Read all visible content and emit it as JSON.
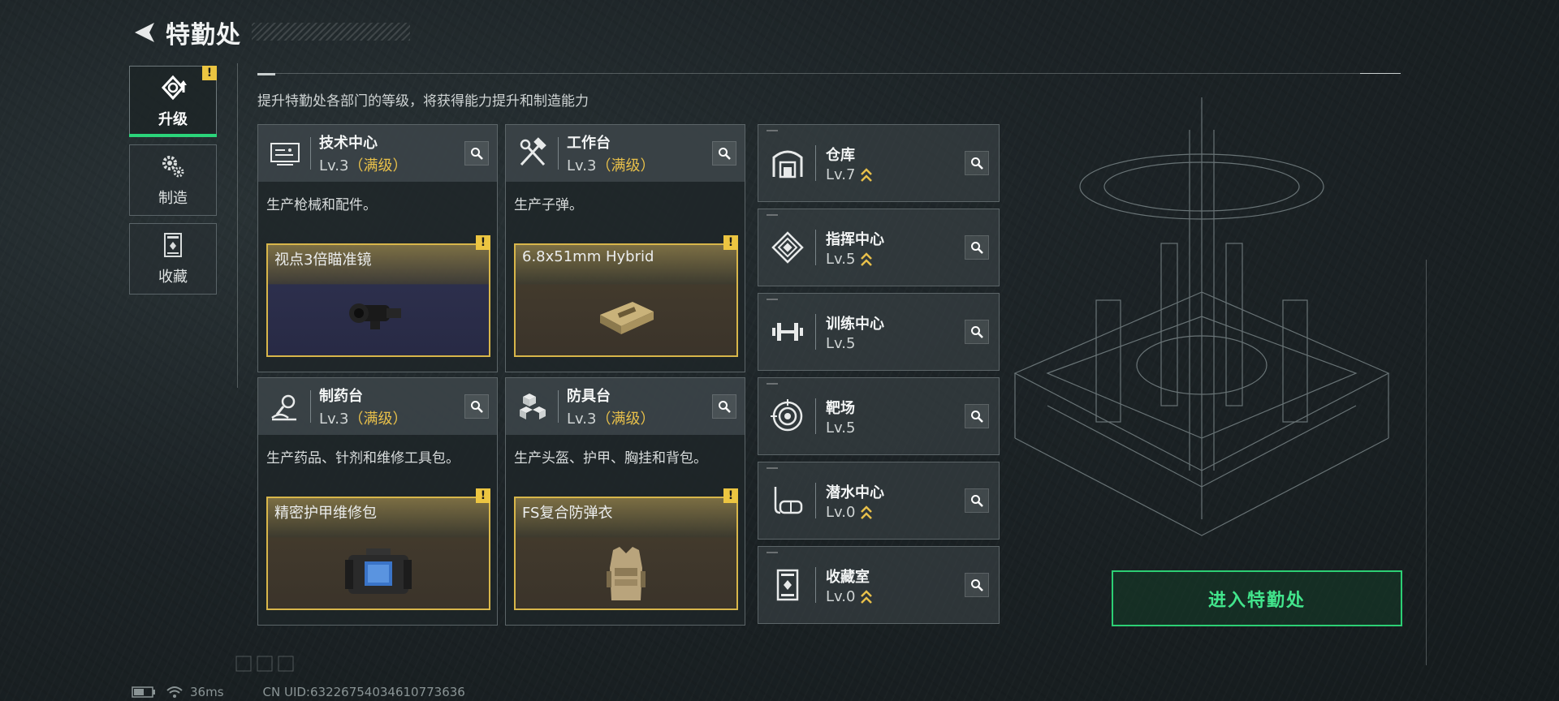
{
  "header": {
    "title": "特勤处"
  },
  "sidenav": [
    {
      "label": "升级",
      "icon": "upgrade-icon",
      "active": true,
      "warning": "!"
    },
    {
      "label": "制造",
      "icon": "gears-icon",
      "active": false
    },
    {
      "label": "收藏",
      "icon": "collection-icon",
      "active": false
    }
  ],
  "subtitle": "提升特勤处各部门的等级，将获得能力提升和制造能力",
  "cards": [
    {
      "name": "技术中心",
      "level": "Lv.3",
      "max": "（满级）",
      "icon": "tech-center-icon",
      "desc": "生产枪械和配件。",
      "product": "视点3倍瞄准镜",
      "warning": "!"
    },
    {
      "name": "工作台",
      "level": "Lv.3",
      "max": "（满级）",
      "icon": "workbench-icon",
      "desc": "生产子弹。",
      "product": "6.8x51mm Hybrid",
      "warning": "!"
    },
    {
      "name": "制药台",
      "level": "Lv.3",
      "max": "（满级）",
      "icon": "pharmacy-icon",
      "desc": "生产药品、针剂和维修工具包。",
      "product": "精密护甲维修包",
      "warning": "!"
    },
    {
      "name": "防具台",
      "level": "Lv.3",
      "max": "（满级）",
      "icon": "armor-bench-icon",
      "desc": "生产头盔、护甲、胸挂和背包。",
      "product": "FS复合防弹衣",
      "warning": "!"
    }
  ],
  "small_cards": [
    {
      "name": "仓库",
      "level": "Lv.7",
      "upgradable": true,
      "icon": "warehouse-icon"
    },
    {
      "name": "指挥中心",
      "level": "Lv.5",
      "upgradable": true,
      "icon": "command-center-icon"
    },
    {
      "name": "训练中心",
      "level": "Lv.5",
      "upgradable": false,
      "icon": "dumbbell-icon"
    },
    {
      "name": "靶场",
      "level": "Lv.5",
      "upgradable": false,
      "icon": "target-icon"
    },
    {
      "name": "潜水中心",
      "level": "Lv.0",
      "upgradable": true,
      "icon": "dive-mask-icon"
    },
    {
      "name": "收藏室",
      "level": "Lv.0",
      "upgradable": true,
      "icon": "collection-room-icon"
    }
  ],
  "enter_button": "进入特勤处",
  "status": {
    "ping": "36ms",
    "uid": "CN UID:63226754034610773636"
  },
  "colors": {
    "accent_green": "#2ccf74",
    "gold": "#d8b64a",
    "warning": "#ecc541"
  }
}
